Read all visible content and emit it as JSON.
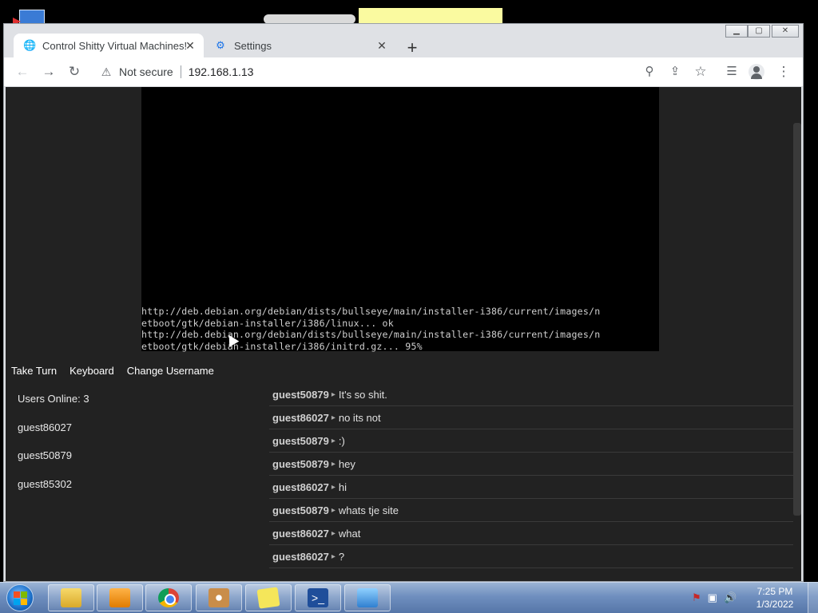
{
  "browser": {
    "tabs": [
      {
        "title": "Control Shitty Virtual Machines!",
        "icon": "globe-icon",
        "active": true
      },
      {
        "title": "Settings",
        "icon": "gear-icon",
        "active": false
      }
    ],
    "address": {
      "security_label": "Not secure",
      "url": "192.168.1.13"
    },
    "window_controls": [
      "minimize",
      "maximize",
      "close"
    ]
  },
  "vm": {
    "console_lines": [
      "http://deb.debian.org/debian/dists/bullseye/main/installer-i386/current/images/n",
      "etboot/gtk/debian-installer/i386/linux... ok",
      "http://deb.debian.org/debian/dists/bullseye/main/installer-i386/current/images/n",
      "etboot/gtk/debian-installer/i386/initrd.gz... 95%"
    ],
    "controls": {
      "take_turn": "Take Turn",
      "keyboard": "Keyboard",
      "change_username": "Change Username"
    }
  },
  "users": {
    "online_label": "Users Online: 3",
    "list": [
      "guest86027",
      "guest50879",
      "guest85302"
    ]
  },
  "chat": {
    "messages": [
      {
        "user": "guest50879",
        "text": "It's so shit."
      },
      {
        "user": "guest86027",
        "text": "no its not"
      },
      {
        "user": "guest50879",
        "text": ":)"
      },
      {
        "user": "guest50879",
        "text": "hey"
      },
      {
        "user": "guest86027",
        "text": "hi"
      },
      {
        "user": "guest50879",
        "text": "whats tje site"
      },
      {
        "user": "guest86027",
        "text": "what"
      },
      {
        "user": "guest86027",
        "text": "?"
      }
    ]
  },
  "taskbar": {
    "apps": [
      "file-explorer",
      "media-player",
      "chrome",
      "paint",
      "sticky-notes",
      "powershell",
      "control-panel"
    ],
    "clock": {
      "time": "7:25 PM",
      "date": "1/3/2022"
    }
  }
}
